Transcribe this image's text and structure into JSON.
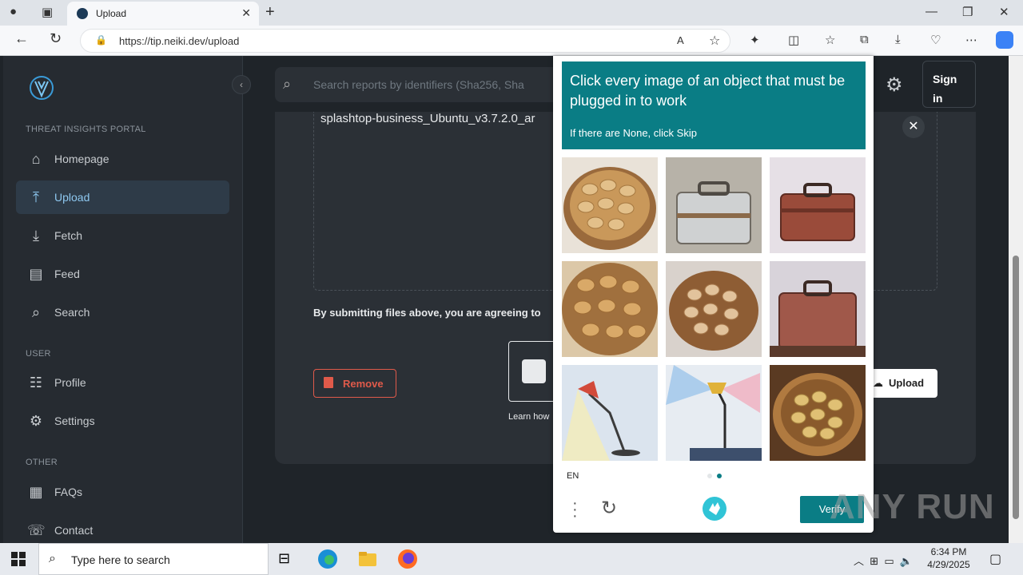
{
  "browser": {
    "tab_title": "Upload",
    "url": "https://tip.neiki.dev/upload",
    "tab_close": "✕",
    "new_tab": "+"
  },
  "sidebar": {
    "section_portal": "THREAT INSIGHTS PORTAL",
    "section_user": "USER",
    "section_other": "OTHER",
    "items": [
      {
        "label": "Homepage",
        "icon": "home-icon"
      },
      {
        "label": "Upload",
        "icon": "upload-icon"
      },
      {
        "label": "Fetch",
        "icon": "fetch-icon"
      },
      {
        "label": "Feed",
        "icon": "feed-icon"
      },
      {
        "label": "Search",
        "icon": "search-icon"
      },
      {
        "label": "Profile",
        "icon": "profile-icon"
      },
      {
        "label": "Settings",
        "icon": "gear-icon"
      },
      {
        "label": "FAQs",
        "icon": "faq-icon"
      },
      {
        "label": "Contact",
        "icon": "contact-icon"
      }
    ]
  },
  "header": {
    "search_placeholder": "Search reports by identifiers (Sha256, Sha",
    "signin_label": "Sign in"
  },
  "upload": {
    "filename": "splashtop-business_Ubuntu_v3.7.2.0_ar",
    "terms": "By submitting files above, you are agreeing to",
    "remove_label": "Remove",
    "learn_text": "Learn how",
    "upload_label": "Upload"
  },
  "captcha": {
    "title": "Click every image of an object that must be plugged in to work",
    "subtitle": "If there are None, click Skip",
    "lang": "EN",
    "verify_label": "Verify",
    "tiles": [
      "potatoes",
      "suitcase",
      "suitcase",
      "potatoes",
      "potatoes",
      "suitcase",
      "lamp",
      "lamp",
      "potatoes"
    ]
  },
  "watermark": "ANY RUN",
  "taskbar": {
    "search_placeholder": "Type here to search",
    "time": "6:34 PM",
    "date": "4/29/2025"
  },
  "colors": {
    "accent": "#0a7d85",
    "danger": "#e05a4a",
    "active_nav": "#2e3b48"
  }
}
